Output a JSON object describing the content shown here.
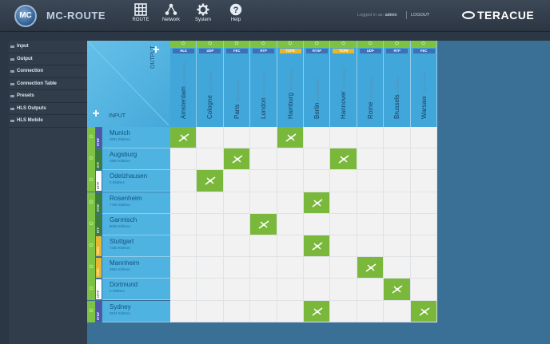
{
  "app": {
    "title": "MC-ROUTE",
    "logo_text": "MC",
    "brand": "TERACUE",
    "logged_in_prefix": "Logged in as:",
    "user": "admin",
    "logout": "LOGOUT"
  },
  "nav": [
    {
      "label": "ROUTE",
      "icon": "grid-icon"
    },
    {
      "label": "Network",
      "icon": "network-icon"
    },
    {
      "label": "System",
      "icon": "gear-icon"
    },
    {
      "label": "Help",
      "icon": "help-icon"
    }
  ],
  "sidebar": {
    "items": [
      {
        "label": "Input"
      },
      {
        "label": "Output"
      },
      {
        "label": "Connection"
      },
      {
        "label": "Connection Table"
      },
      {
        "label": "Presets"
      },
      {
        "label": "HLS Outputs"
      },
      {
        "label": "HLS Mobile"
      }
    ]
  },
  "matrix": {
    "output_label": "OUTPUT",
    "input_label": "INPUT",
    "add_symbol": "+",
    "power_symbol": "⏻",
    "outputs": [
      {
        "name": "Amsterdam",
        "detail": "2000 Kbit/sec",
        "tag": "HLS",
        "tag_color": "#3f6fb5"
      },
      {
        "name": "Cologne",
        "detail": "2002 Kbit/sec",
        "tag": "UDP",
        "tag_color": "#3f6fb5"
      },
      {
        "name": "Paris",
        "detail": "9525 Kbit/sec",
        "tag": "FEC",
        "tag_color": "#3f6fb5"
      },
      {
        "name": "London",
        "detail": "1795 Kbit/sec",
        "tag": "RTP",
        "tag_color": "#3f6fb5"
      },
      {
        "name": "Hamburg",
        "detail": "2067 Kbit/sec",
        "tag": "TCPS",
        "tag_color": "#e8b730"
      },
      {
        "name": "Berlin",
        "detail": "1842 Kbit/sec",
        "tag": "RTSP",
        "tag_color": "#3f6fb5"
      },
      {
        "name": "Hannover",
        "detail": "7220 Kbit/sec",
        "tag": "TCPS",
        "tag_color": "#e8b730"
      },
      {
        "name": "Rome",
        "detail": "3700 Kbit/sec",
        "tag": "UDP",
        "tag_color": "#3f6fb5"
      },
      {
        "name": "Brussels",
        "detail": "0 Kbit/sec",
        "tag": "RTP",
        "tag_color": "#3f6fb5"
      },
      {
        "name": "Warsaw",
        "detail": "5420 Kbit/sec",
        "tag": "FEC",
        "tag_color": "#3f6fb5"
      }
    ],
    "inputs": [
      {
        "name": "Munich",
        "detail": "2001 Kbit/sec",
        "tag": "RTMP",
        "tag_color": "#4e56a8",
        "connected": [
          0,
          4
        ]
      },
      {
        "name": "Augsburg",
        "detail": "1960 Kbit/sec",
        "tag": "RTP",
        "tag_color": "#3b7d3a",
        "connected": [
          2,
          6
        ]
      },
      {
        "name": "Odelzhausen",
        "detail": "0 Kbit/sec",
        "tag": "HTTP",
        "tag_color": "#ffffff",
        "connected": [
          1
        ]
      },
      {
        "name": "Rosenheim",
        "detail": "7795 Kbit/sec",
        "tag": "RTSP",
        "tag_color": "#3b7d3a",
        "connected": [
          5
        ]
      },
      {
        "name": "Garmisch",
        "detail": "9036 Kbit/sec",
        "tag": "RTP",
        "tag_color": "#3b7d3a",
        "connected": [
          3
        ]
      },
      {
        "name": "Stuttgart",
        "detail": "7320 Kbit/sec",
        "tag": "TCPS",
        "tag_color": "#e8b730",
        "connected": [
          5
        ]
      },
      {
        "name": "Mannheim",
        "detail": "3994 Kbit/sec",
        "tag": "TCPS",
        "tag_color": "#e8b730",
        "connected": [
          7
        ]
      },
      {
        "name": "Dortmund",
        "detail": "0 Kbit/sec",
        "tag": "HTTP",
        "tag_color": "#ffffff",
        "connected": [
          8
        ]
      },
      {
        "name": "Sydney",
        "detail": "2574 Kbit/sec",
        "tag": "RTMP",
        "tag_color": "#4e56a8",
        "connected": [
          5,
          9
        ]
      }
    ]
  },
  "colors": {
    "accent_green": "#7ab83b",
    "header_blue": "#41a6da",
    "input_blue": "#4fb3e2",
    "cell_empty": "#f2f2f2"
  }
}
